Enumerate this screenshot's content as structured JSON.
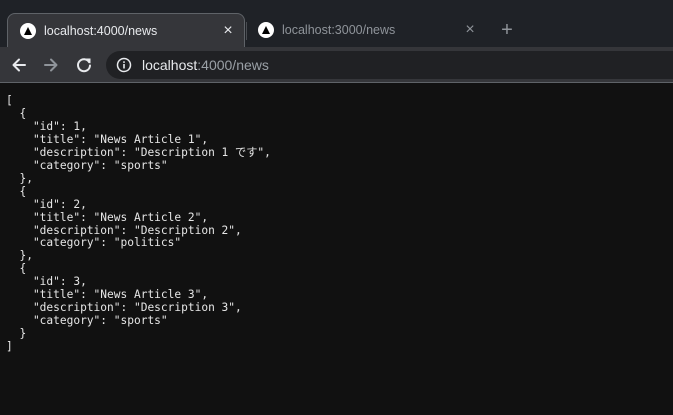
{
  "tabs": [
    {
      "title": "localhost:4000/news",
      "close_glyph": "×",
      "favicon": "nextjs-icon",
      "active": true
    },
    {
      "title": "localhost:3000/news",
      "close_glyph": "×",
      "favicon": "nextjs-icon",
      "active": false
    }
  ],
  "new_tab_glyph": "+",
  "toolbar": {
    "back_icon": "arrow-left-icon",
    "forward_icon": "arrow-right-icon",
    "reload_icon": "reload-icon",
    "info_icon": "info-icon"
  },
  "address": {
    "host": "localhost",
    "rest": ":4000/news"
  },
  "page": {
    "json_text": "[\n  {\n    \"id\": 1,\n    \"title\": \"News Article 1\",\n    \"description\": \"Description 1 です\",\n    \"category\": \"sports\"\n  },\n  {\n    \"id\": 2,\n    \"title\": \"News Article 2\",\n    \"description\": \"Description 2\",\n    \"category\": \"politics\"\n  },\n  {\n    \"id\": 3,\n    \"title\": \"News Article 3\",\n    \"description\": \"Description 3\",\n    \"category\": \"sports\"\n  }\n]"
  },
  "colors": {
    "tabstrip_bg": "#1f2227",
    "toolbar_bg": "#35363a",
    "omnibox_bg": "#202124",
    "content_bg": "#111111",
    "text_primary": "#e8eaed",
    "text_muted": "#9aa0a6"
  }
}
